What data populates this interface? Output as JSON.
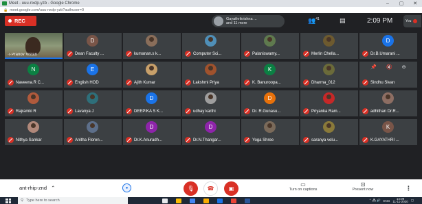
{
  "window": {
    "title": "Meet - uuu-nxdp-yzb - Google Chrome",
    "minimize": "–",
    "maximize": "▢",
    "close": "✕"
  },
  "address": {
    "url": "meet.google.com/uuu-nxdp-yzb?authuser=0"
  },
  "topbar": {
    "rec_label": "REC",
    "presenter_line1": "Gayathrikrishna ...",
    "presenter_line2": "and 11 more",
    "people_count": "41",
    "time": "2:09 PM",
    "you_label": "You"
  },
  "colors": {
    "accent": "#1a73e8",
    "danger": "#d93025",
    "tile": "#3c4043",
    "background": "#202124"
  },
  "participants": [
    {
      "name": "Pranov Vistan",
      "initial": "",
      "color": "",
      "type": "video"
    },
    {
      "name": "Dean Faculty ...",
      "initial": "D",
      "color": "#795548",
      "type": "letter"
    },
    {
      "name": "kumanan.s k...",
      "initial": "",
      "color": "#8a6e5a",
      "type": "photo"
    },
    {
      "name": "Computer Sci...",
      "initial": "",
      "color": "#4f8fb8",
      "type": "photo"
    },
    {
      "name": "Palaniswamy...",
      "initial": "",
      "color": "#5f7a4e",
      "type": "photo"
    },
    {
      "name": "Merlin Chella...",
      "initial": "",
      "color": "#6d5a2f",
      "type": "photo"
    },
    {
      "name": "Dr.B.Umarani ...",
      "initial": "D",
      "color": "#1a73e8",
      "type": "letter"
    },
    {
      "name": "Naveena.R C...",
      "initial": "N",
      "color": "#0b8043",
      "type": "letter"
    },
    {
      "name": "English HOD",
      "initial": "E",
      "color": "#1a73e8",
      "type": "letter"
    },
    {
      "name": "Ajith Kumar",
      "initial": "",
      "color": "#c8a06a",
      "type": "photo"
    },
    {
      "name": "Lakshmi Priya",
      "initial": "",
      "color": "#a0522d",
      "type": "photo"
    },
    {
      "name": "K. Banuroopa...",
      "initial": "K",
      "color": "#0b8043",
      "type": "letter"
    },
    {
      "name": "Dharma_012",
      "initial": "",
      "color": "#6b6b3a",
      "type": "photo"
    },
    {
      "name": "Sindhu Sivan",
      "initial": "",
      "color": "",
      "type": "controls"
    },
    {
      "name": "Rajramki R",
      "initial": "",
      "color": "#b05a3c",
      "type": "photo"
    },
    {
      "name": "Lavanya J",
      "initial": "",
      "color": "#2e6f7a",
      "type": "photo"
    },
    {
      "name": "DEEPIKA S K...",
      "initial": "D",
      "color": "#1a73e8",
      "type": "letter"
    },
    {
      "name": "udhay karthi",
      "initial": "",
      "color": "#9e9e9e",
      "type": "photo"
    },
    {
      "name": "Dr. R.Gunasu...",
      "initial": "D",
      "color": "#e8710a",
      "type": "letter"
    },
    {
      "name": "Priyanka Ram...",
      "initial": "",
      "color": "#c62828",
      "type": "photo"
    },
    {
      "name": "adhithan Dr.R...",
      "initial": "",
      "color": "#8d6e63",
      "type": "photo"
    },
    {
      "name": "Nithya Sankar",
      "initial": "",
      "color": "#b0887a",
      "type": "photo"
    },
    {
      "name": "Anitha Floren...",
      "initial": "",
      "color": "#5d6f8a",
      "type": "photo"
    },
    {
      "name": "Dr.K.Anuradh...",
      "initial": "D",
      "color": "#8e24aa",
      "type": "letter"
    },
    {
      "name": "Dr.N.Thangar...",
      "initial": "D",
      "color": "#8e24aa",
      "type": "letter"
    },
    {
      "name": "Yoga Shree",
      "initial": "",
      "color": "#7a6a5a",
      "type": "photo"
    },
    {
      "name": "saranya velu...",
      "initial": "",
      "color": "#8a7a3a",
      "type": "photo"
    },
    {
      "name": "K.GAYATHRI ...",
      "initial": "K",
      "color": "#795548",
      "type": "letter"
    }
  ],
  "tile_controls": {
    "pin_icon": "📌",
    "mute_icon": "🔇",
    "remove_icon": "⊖"
  },
  "bottom": {
    "meeting_code": "ant-rhip-znd",
    "chevron": "^",
    "captions_label": "Turn on captions",
    "present_label": "Present now",
    "more": "⋮"
  },
  "taskbar": {
    "search_placeholder": "Type here to search",
    "language": "ENG",
    "clock_time": "14:09",
    "clock_date": "11-11-2020"
  }
}
